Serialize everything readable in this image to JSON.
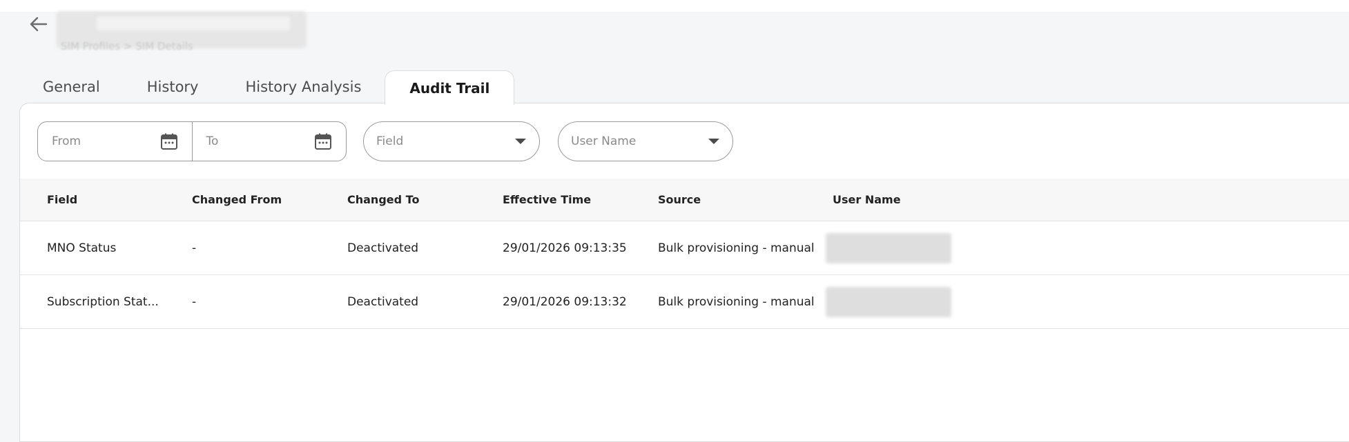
{
  "header": {
    "back_icon": "arrow-left-icon",
    "breadcrumb": "SIM Profiles > SIM Details"
  },
  "tabs": [
    {
      "label": "General",
      "active": false
    },
    {
      "label": "History",
      "active": false
    },
    {
      "label": "History Analysis",
      "active": false
    },
    {
      "label": "Audit Trail",
      "active": true
    }
  ],
  "filters": {
    "from_placeholder": "From",
    "to_placeholder": "To",
    "calendar_icon": "calendar-icon",
    "field_placeholder": "Field",
    "user_name_placeholder": "User Name",
    "dropdown_icon": "caret-down-icon"
  },
  "table": {
    "columns": [
      "Field",
      "Changed From",
      "Changed To",
      "Effective Time",
      "Source",
      "User Name"
    ],
    "rows": [
      {
        "field": "MNO Status",
        "changed_from": "-",
        "changed_to": "Deactivated",
        "effective_time": "29/01/2026 09:13:35",
        "source": "Bulk provisioning - manual"
      },
      {
        "field": "Subscription Stat...",
        "changed_from": "-",
        "changed_to": "Deactivated",
        "effective_time": "29/01/2026 09:13:32",
        "source": "Bulk provisioning - manual"
      }
    ]
  },
  "colors": {
    "background": "#f5f6f7",
    "panel": "#ffffff",
    "border": "#9a9a9a",
    "text": "#222222"
  }
}
